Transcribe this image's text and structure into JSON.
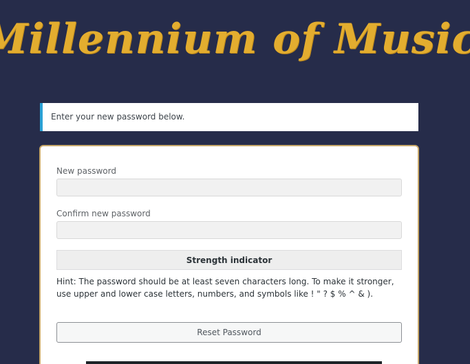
{
  "site": {
    "logo_text": "Millennium of Music"
  },
  "message": {
    "text": "Enter your new password below."
  },
  "form": {
    "new_password_label": "New password",
    "new_password_value": "",
    "confirm_password_label": "Confirm new password",
    "confirm_password_value": "",
    "strength_indicator": "Strength indicator",
    "hint": "Hint: The password should be at least seven characters long. To make it stronger, use upper and lower case letters, numbers, and symbols like ! \" ? $ % ^ & ).",
    "reset_button": "Reset Password"
  },
  "colors": {
    "background": "#262c4a",
    "logo": "#e3ad2f",
    "message_accent": "#2aa1d5",
    "form_border": "#c9a96a"
  }
}
